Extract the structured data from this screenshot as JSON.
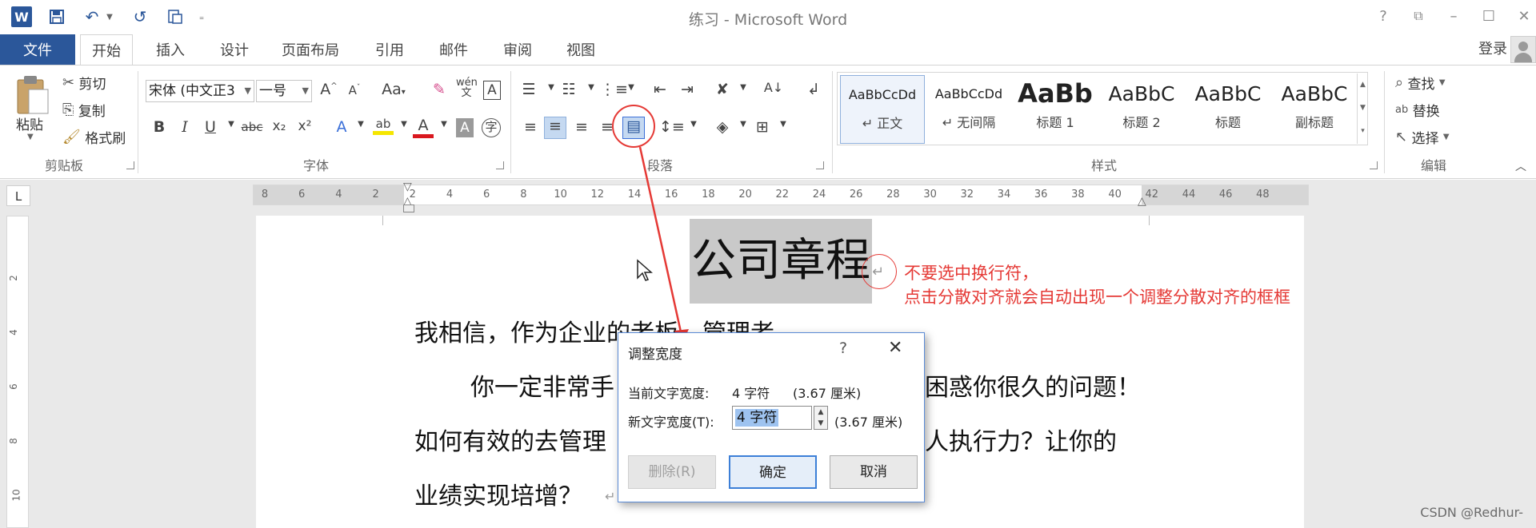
{
  "titlebar": {
    "doc_title": "练习 - Microsoft Word",
    "qa_icons": [
      "word-app-icon",
      "save-icon",
      "undo-icon",
      "redo-icon",
      "new-doc-icon",
      "customize-qa-icon"
    ],
    "win_buttons": [
      "?",
      "⌧",
      "–",
      "☐",
      "✕"
    ]
  },
  "tabs": {
    "file": "文件",
    "items": [
      "开始",
      "插入",
      "设计",
      "页面布局",
      "引用",
      "邮件",
      "审阅",
      "视图"
    ],
    "active": "开始",
    "login": "登录"
  },
  "ribbon": {
    "clipboard": {
      "label": "剪贴板",
      "paste": "粘贴",
      "cut": "剪切",
      "copy": "复制",
      "format_painter": "格式刷"
    },
    "font": {
      "label": "字体",
      "font_name": "宋体 (中文正3",
      "font_size": "一号",
      "row1_icons": [
        "A",
        "A",
        "Aa",
        "clear-format-icon",
        "wén",
        "A"
      ],
      "row2_icons": [
        "B",
        "I",
        "U",
        "abc",
        "x₂",
        "x²",
        "A",
        "ab",
        "A",
        "A",
        "字"
      ]
    },
    "paragraph": {
      "label": "段落"
    },
    "styles": {
      "label": "样式",
      "items": [
        {
          "preview": "AaBbCcDd",
          "name": "↵ 正文"
        },
        {
          "preview": "AaBbCcDd",
          "name": "↵ 无间隔"
        },
        {
          "preview": "AaBb",
          "name": "标题 1"
        },
        {
          "preview": "AaBbC",
          "name": "标题 2"
        },
        {
          "preview": "AaBbC",
          "name": "标题"
        },
        {
          "preview": "AaBbC",
          "name": "副标题"
        }
      ]
    },
    "editing": {
      "label": "编辑",
      "find": "查找",
      "replace": "替换",
      "select": "选择"
    }
  },
  "ruler": {
    "h_ticks": [
      "8",
      "6",
      "4",
      "2",
      "2",
      "4",
      "6",
      "8",
      "10",
      "12",
      "14",
      "16",
      "18",
      "20",
      "22",
      "24",
      "26",
      "28",
      "30",
      "32",
      "34",
      "36",
      "38",
      "40",
      "42",
      "44",
      "46",
      "48"
    ],
    "v_ticks": [
      "2",
      "4",
      "6",
      "8",
      "10"
    ],
    "tab_selector": "L"
  },
  "document": {
    "heading": "公司章程",
    "line1": "我相信，作为企业的老板、管理者，",
    "line2a": "你一定非常手",
    "line2b": "困惑你很久的问题！",
    "line3a": "如何有效的去管理",
    "line3b": "人执行力？让你的",
    "line4": "业绩实现培增？",
    "para_mark": "↵"
  },
  "annotation": {
    "line1": "不要选中换行符，",
    "line2": "点击分散对齐就会自动出现一个调整分散对齐的框框",
    "color": "#e53935"
  },
  "dialog": {
    "title": "调整宽度",
    "help": "?",
    "close": "✕",
    "current_label": "当前文字宽度:",
    "current_value": "4 字符",
    "current_cm": "(3.67 厘米)",
    "new_label": "新文字宽度(T):",
    "new_value": "4 字符",
    "new_cm": "(3.67 厘米)",
    "btn_remove": "删除(R)",
    "btn_ok": "确定",
    "btn_cancel": "取消"
  },
  "watermark": "CSDN @Redhur-",
  "colors": {
    "brand": "#2b579a",
    "selection": "#c9c9c9"
  }
}
